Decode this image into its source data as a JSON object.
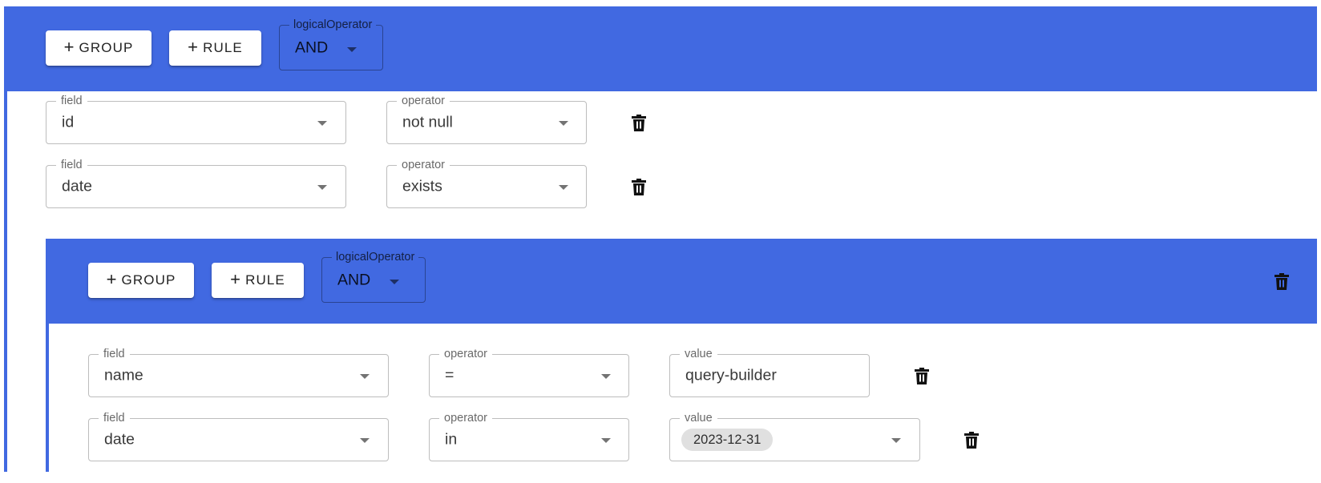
{
  "colors": {
    "group_band": "#4169e1",
    "rail": "#4169e1"
  },
  "root_group": {
    "add_group_label": "GROUP",
    "add_rule_label": "RULE",
    "logical_operator": {
      "legend": "logicalOperator",
      "value": "AND"
    },
    "rules": [
      {
        "field_legend": "field",
        "field": "id",
        "operator_legend": "operator",
        "operator": "not null"
      },
      {
        "field_legend": "field",
        "field": "date",
        "operator_legend": "operator",
        "operator": "exists"
      }
    ]
  },
  "sub_group": {
    "add_group_label": "GROUP",
    "add_rule_label": "RULE",
    "logical_operator": {
      "legend": "logicalOperator",
      "value": "AND"
    },
    "rules": [
      {
        "field_legend": "field",
        "field": "name",
        "operator_legend": "operator",
        "operator": "=",
        "value_legend": "value",
        "value": "query-builder"
      },
      {
        "field_legend": "field",
        "field": "date",
        "operator_legend": "operator",
        "operator": "in",
        "value_legend": "value",
        "value_chip": "2023-12-31"
      }
    ]
  },
  "icons": {
    "add": "plus-icon",
    "dropdown": "caret-down-icon",
    "delete": "trash-icon"
  }
}
